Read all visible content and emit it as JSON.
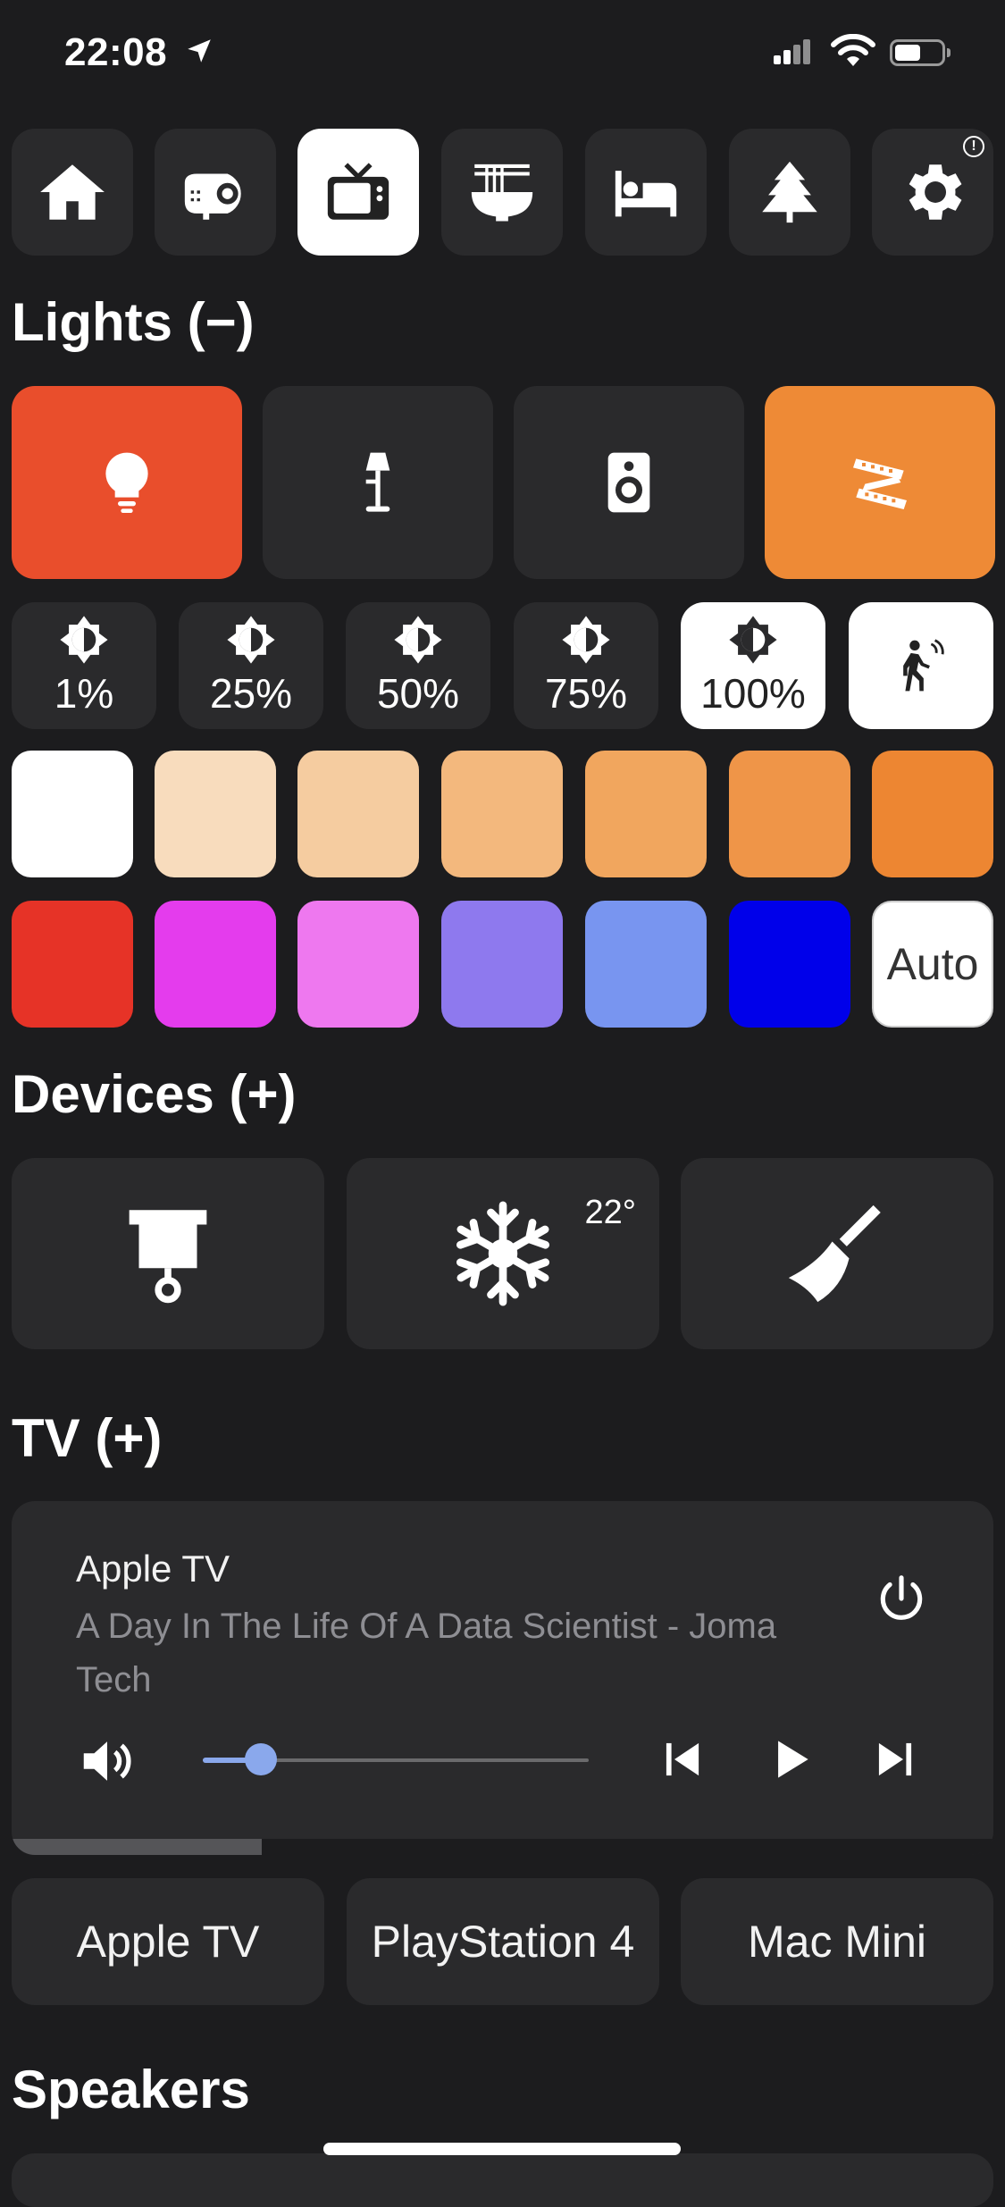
{
  "status_bar": {
    "time": "22:08"
  },
  "rooms": [
    {
      "icon": "home-icon"
    },
    {
      "icon": "projector-icon"
    },
    {
      "icon": "tv-icon",
      "active": true
    },
    {
      "icon": "noodle-bowl-icon"
    },
    {
      "icon": "bed-icon"
    },
    {
      "icon": "tree-icon"
    },
    {
      "icon": "gear-icon",
      "badge": "!"
    }
  ],
  "lights": {
    "title": "Lights (−)",
    "buttons": [
      {
        "icon": "bulb-icon",
        "color": "#e94e2c"
      },
      {
        "icon": "floor-lamp-icon",
        "color": "#2a2a2c"
      },
      {
        "icon": "speaker-icon",
        "color": "#2a2a2c"
      },
      {
        "icon": "led-strip-icon",
        "color": "#ee8a36"
      }
    ],
    "brightness": [
      {
        "label": "1%"
      },
      {
        "label": "25%"
      },
      {
        "label": "50%"
      },
      {
        "label": "75%"
      },
      {
        "label": "100%",
        "active": true
      }
    ],
    "motion_icon": "motion-sensor-icon",
    "swatches_row1": [
      "#ffffff",
      "#f8dcbd",
      "#f5cca0",
      "#f3b87d",
      "#f1a65e",
      "#ef9548",
      "#ed8632"
    ],
    "swatches_row2": [
      "#e63327",
      "#e43ced",
      "#ee78ef",
      "#8e79ee",
      "#7895f0",
      "#0000ea"
    ],
    "auto_label": "Auto"
  },
  "devices": {
    "title": "Devices (+)",
    "items": [
      {
        "icon": "projector-screen-icon"
      },
      {
        "icon": "snowflake-icon",
        "temperature": "22°"
      },
      {
        "icon": "vacuum-broom-icon"
      }
    ]
  },
  "tv": {
    "title": "TV (+)",
    "player": {
      "source": "Apple TV",
      "media_title": "A Day In The Life Of A Data Scientist - Joma Tech",
      "volume": 0.15,
      "progress": 0.255
    },
    "sources": [
      "Apple TV",
      "PlayStation 4",
      "Mac Mini"
    ]
  },
  "speakers": {
    "title": "Speakers"
  }
}
